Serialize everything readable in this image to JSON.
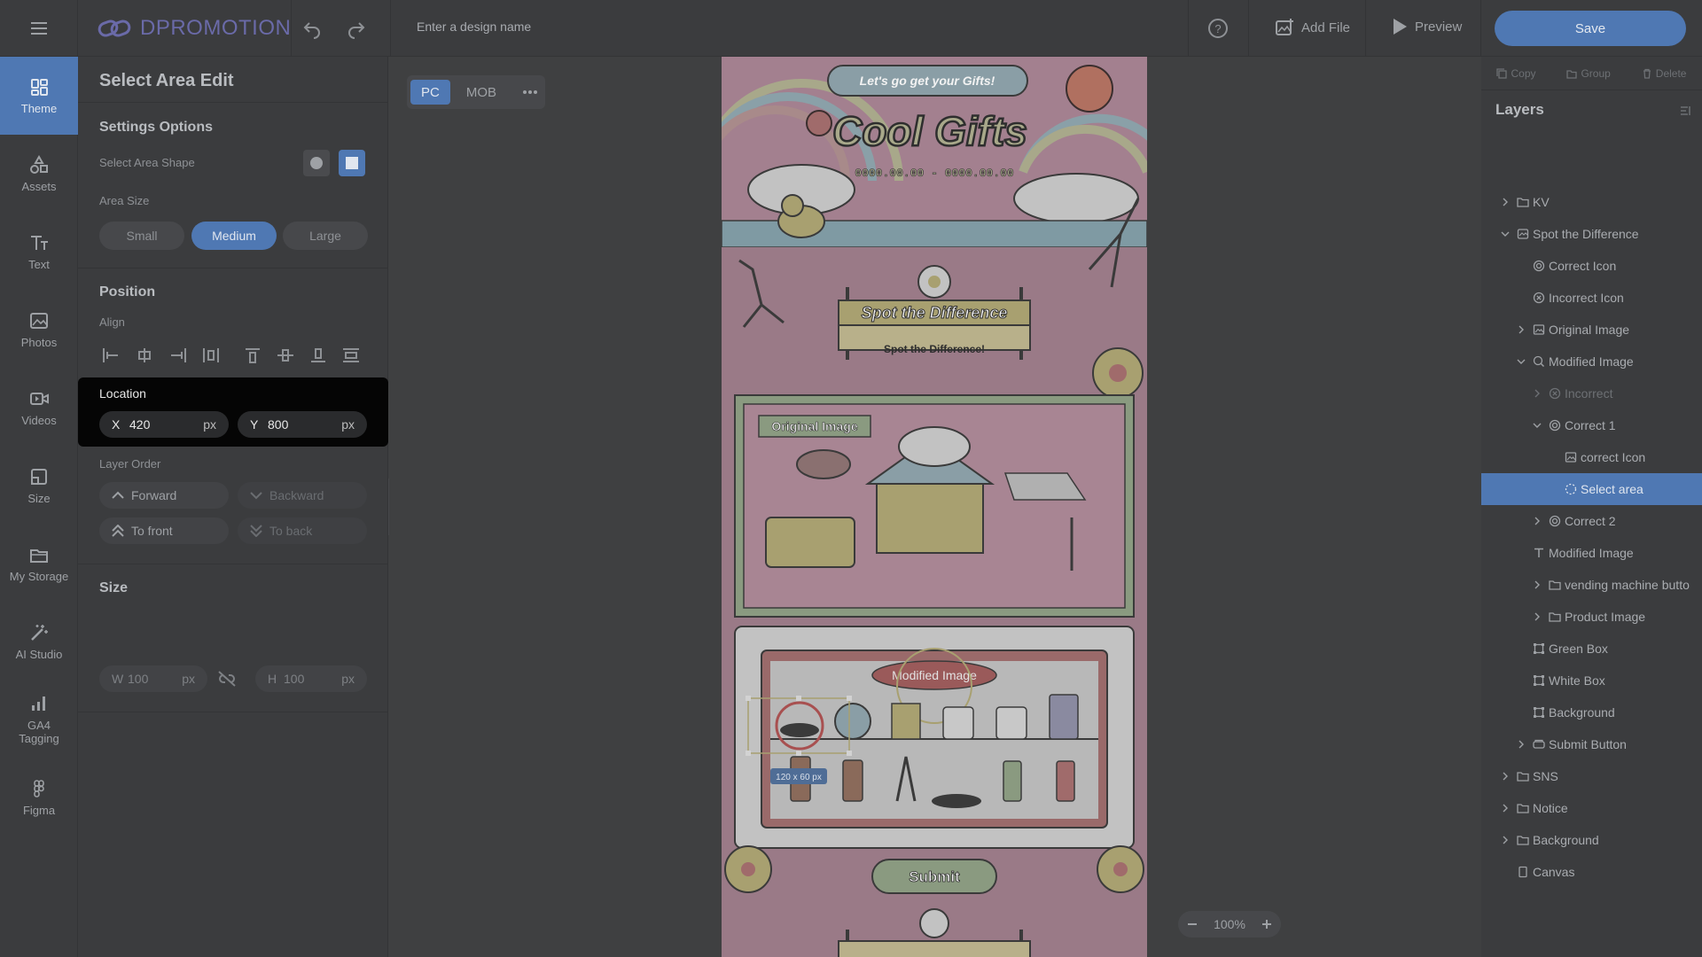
{
  "app": {
    "brand": "DPROMOTION"
  },
  "header": {
    "design_name_placeholder": "Enter a design name",
    "add_file": "Add File",
    "preview": "Preview",
    "save": "Save"
  },
  "nav": [
    {
      "label": "Theme",
      "icon": "theme-icon",
      "active": true
    },
    {
      "label": "Assets",
      "icon": "assets-icon"
    },
    {
      "label": "Text",
      "icon": "text-icon"
    },
    {
      "label": "Photos",
      "icon": "photos-icon"
    },
    {
      "label": "Videos",
      "icon": "videos-icon"
    },
    {
      "label": "Size",
      "icon": "size-icon"
    },
    {
      "label": "My Storage",
      "icon": "storage-icon"
    },
    {
      "label": "AI Studio",
      "icon": "ai-studio-icon"
    },
    {
      "label": "GA4 Tagging",
      "icon": "ga4-icon"
    },
    {
      "label": "Figma",
      "icon": "figma-icon"
    }
  ],
  "panel": {
    "title": "Select Area Edit",
    "settings_title": "Settings Options",
    "shape_label": "Select Area Shape",
    "area_size_label": "Area Size",
    "sizes": [
      "Small",
      "Medium",
      "Large"
    ],
    "selected_size": "Medium",
    "position_title": "Position",
    "align_label": "Align",
    "location_label": "Location",
    "x_key": "X",
    "x_value": "420",
    "x_unit": "px",
    "y_key": "Y",
    "y_value": "800",
    "y_unit": "px",
    "layer_order_label": "Layer Order",
    "forward": "Forward",
    "backward": "Backward",
    "to_front": "To front",
    "to_back": "To back",
    "size_title": "Size",
    "w_key": "W",
    "w_value": "100",
    "w_unit": "px",
    "h_key": "H",
    "h_value": "100",
    "h_unit": "px"
  },
  "canvas": {
    "device_tabs": [
      "PC",
      "MOB"
    ],
    "active_device": "PC",
    "zoom": "100%",
    "banner_top": "Let's go get your Gifts!",
    "title": "Cool Gifts",
    "date_range": "0000.00.00 - 0000.00.00",
    "spot_title": "Spot the Difference",
    "spot_subtitle": "Spot the Difference!",
    "original_label": "Original Image",
    "modified_label": "Modified Image",
    "selection_size": "120 x 60 px",
    "submit": "Submit"
  },
  "layers_panel": {
    "copy": "Copy",
    "group": "Group",
    "delete": "Delete",
    "title": "Layers",
    "items": [
      {
        "label": "KV",
        "indent": 0,
        "chevron": "right",
        "icon": "folder"
      },
      {
        "label": "Spot the Difference",
        "indent": 0,
        "chevron": "down",
        "icon": "frame"
      },
      {
        "label": "Correct Icon",
        "indent": 1,
        "chevron": "",
        "icon": "target"
      },
      {
        "label": "Incorrect Icon",
        "indent": 1,
        "chevron": "",
        "icon": "x-circle"
      },
      {
        "label": "Original Image",
        "indent": 1,
        "chevron": "right",
        "icon": "image"
      },
      {
        "label": "Modified Image",
        "indent": 1,
        "chevron": "down",
        "icon": "search"
      },
      {
        "label": "Incorrect",
        "indent": 2,
        "chevron": "right",
        "icon": "x-circle",
        "dim": true
      },
      {
        "label": "Correct 1",
        "indent": 2,
        "chevron": "down",
        "icon": "target"
      },
      {
        "label": "correct Icon",
        "indent": 3,
        "chevron": "",
        "icon": "image"
      },
      {
        "label": "Select area",
        "indent": 3,
        "chevron": "",
        "icon": "dashed-circle",
        "selected": true
      },
      {
        "label": "Correct 2",
        "indent": 2,
        "chevron": "right",
        "icon": "target"
      },
      {
        "label": "Modified Image",
        "indent": 1,
        "chevron": "",
        "icon": "text"
      },
      {
        "label": "vending machine butto",
        "indent": 2,
        "chevron": "right",
        "icon": "folder"
      },
      {
        "label": "Product Image",
        "indent": 2,
        "chevron": "right",
        "icon": "folder"
      },
      {
        "label": "Green Box",
        "indent": 1,
        "chevron": "",
        "icon": "shape"
      },
      {
        "label": "White Box",
        "indent": 1,
        "chevron": "",
        "icon": "shape"
      },
      {
        "label": "Background",
        "indent": 1,
        "chevron": "",
        "icon": "shape"
      },
      {
        "label": "Submit Button",
        "indent": 1,
        "chevron": "right",
        "icon": "button"
      },
      {
        "label": "SNS",
        "indent": 0,
        "chevron": "right",
        "icon": "folder"
      },
      {
        "label": "Notice",
        "indent": 0,
        "chevron": "right",
        "icon": "folder"
      },
      {
        "label": "Background",
        "indent": 0,
        "chevron": "right",
        "icon": "folder"
      },
      {
        "label": "Canvas",
        "indent": 0,
        "chevron": "",
        "icon": "page"
      }
    ]
  },
  "colors": {
    "accent": "#4f78b3",
    "background": "#3f4041",
    "artboard": "#9a7a87"
  }
}
